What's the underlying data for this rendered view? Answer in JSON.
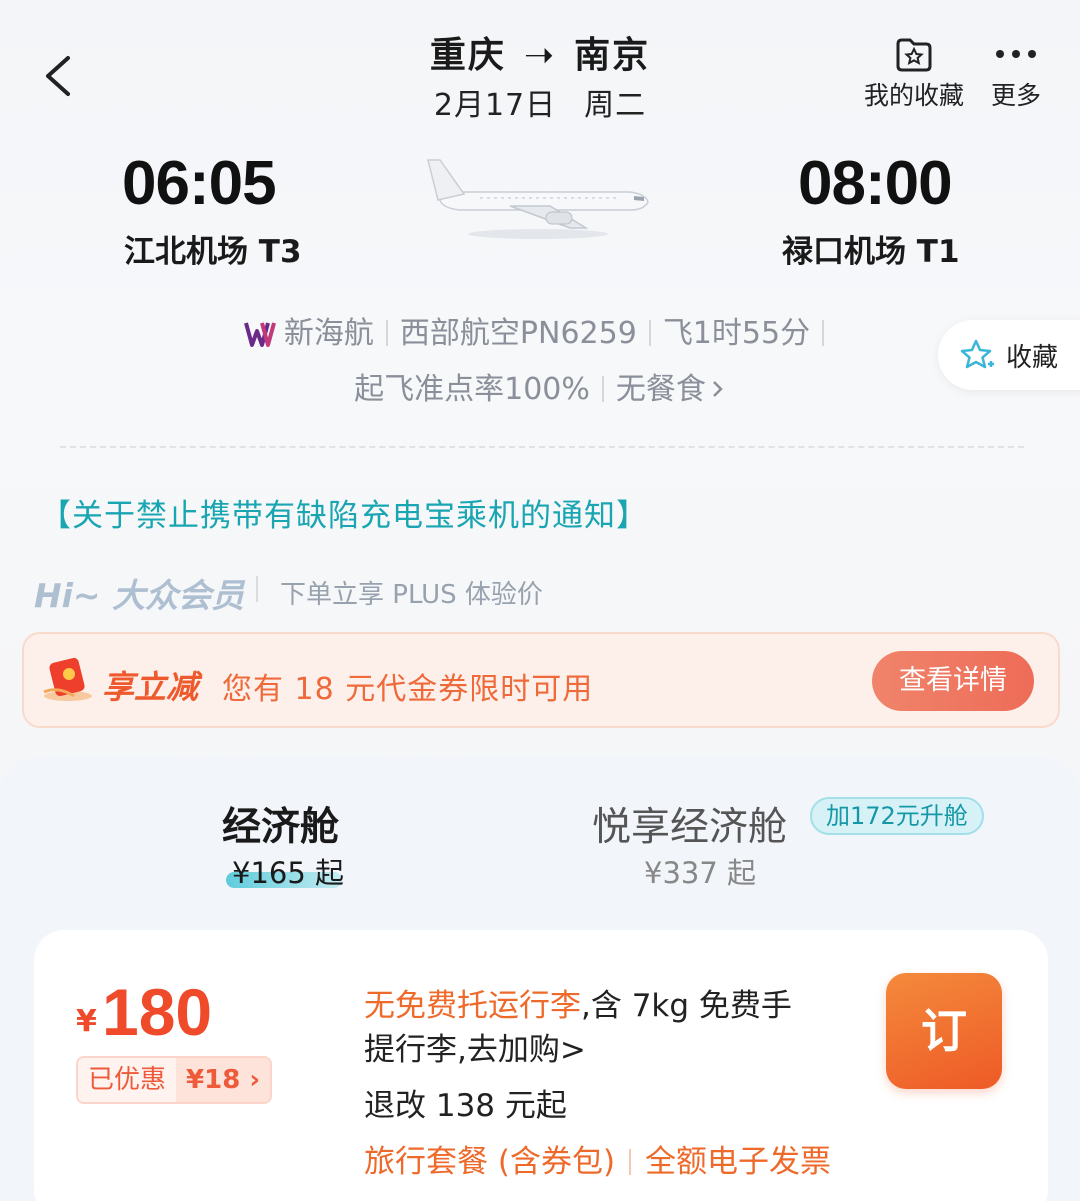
{
  "header": {
    "origin": "重庆",
    "arrow": "➝",
    "destination": "南京",
    "date": "2月17日",
    "weekday": "周二",
    "favorites_label": "我的收藏",
    "more_label": "更多"
  },
  "flight": {
    "departure_time": "06:05",
    "departure_airport": "江北机场 T3",
    "arrival_time": "08:00",
    "arrival_airport": "禄口机场 T1",
    "codeshare_airline": "新海航",
    "operating": "西部航空PN6259",
    "duration": "飞1时55分",
    "on_time_rate": "起飞准点率100%",
    "meal": "无餐食",
    "collect_label": "收藏"
  },
  "notice": "【关于禁止携带有缺陷充电宝乘机的通知】",
  "membership": {
    "greeting": "Hi~ 大众会员",
    "perk": "下单立享 PLUS 体验价"
  },
  "promo": {
    "title": "享立减",
    "text": "您有 18 元代金券限时可用",
    "button": "查看详情"
  },
  "cabins": [
    {
      "name": "经济舱",
      "price": "¥165 起",
      "selected": true
    },
    {
      "name": "悦享经济舱",
      "price": "¥337 起",
      "upgrade": "加172元升舱",
      "selected": false
    }
  ],
  "fare": {
    "currency": "¥",
    "price": "180",
    "discount_label": "已优惠",
    "discount_amount": "¥18 ›",
    "baggage_warn": "无免费托运行李",
    "baggage_line1": ",含 7kg 免费手",
    "baggage_line2": "提行李,去加购>",
    "refund": "退改 138 元起",
    "package": "旅行套餐 (含券包)",
    "invoice": "全额电子发票",
    "book_button": "订"
  },
  "colors": {
    "accent_orange": "#ee5a26",
    "price_red": "#ef4a2a",
    "teal": "#19a6b2"
  }
}
